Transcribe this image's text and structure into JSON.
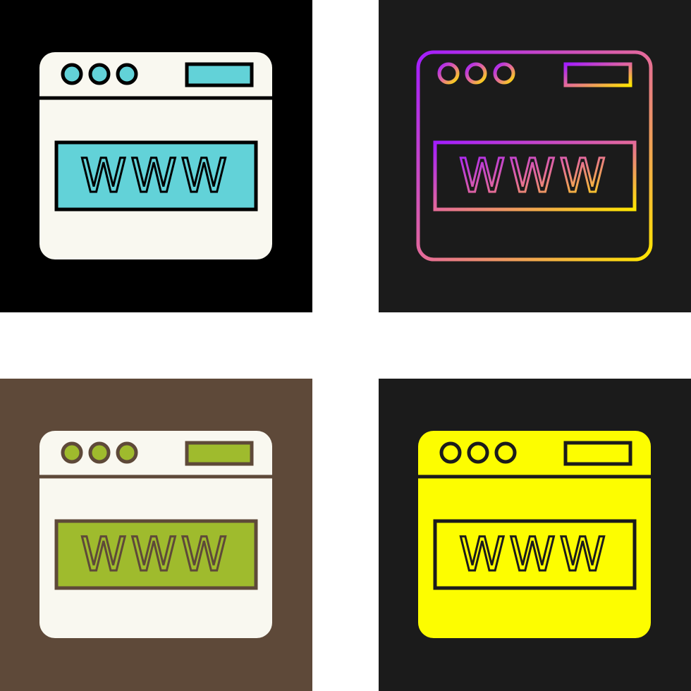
{
  "variants": [
    {
      "name": "flat-color",
      "background": "#000000",
      "window_fill": "#f9f8f0",
      "stroke": "#000000",
      "accent": "#62d2d8",
      "url_text": "WWW"
    },
    {
      "name": "gradient-outline",
      "background": "#1b1b1b",
      "gradient_start": "#a21cff",
      "gradient_mid": "#e46a9a",
      "gradient_end": "#ffe600",
      "url_text": "WWW"
    },
    {
      "name": "flat-color-brown",
      "background": "#5e4939",
      "window_fill": "#f9f8f0",
      "stroke": "#5e4939",
      "accent": "#9fbb2d",
      "url_text": "WWW"
    },
    {
      "name": "glyph-yellow",
      "background": "#1b1b1b",
      "window_fill": "#fdfd00",
      "stroke": "#1b1b1b",
      "accent": "#fdfd00",
      "url_text": "WWW"
    }
  ]
}
